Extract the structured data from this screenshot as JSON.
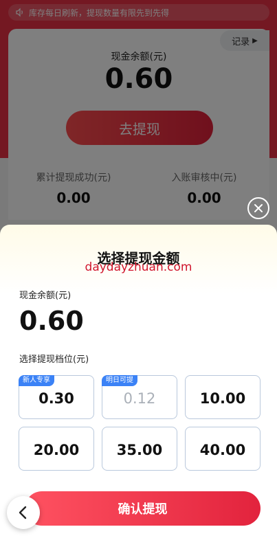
{
  "background": {
    "notice": {
      "icon": "speaker-icon",
      "text": "库存每日刷新，提现数量有限先到先得"
    },
    "balance_card": {
      "record_label": "记录",
      "label": "现金余额(元)",
      "amount": "0.60",
      "withdraw_label": "去提现"
    },
    "stats": [
      {
        "label": "累计提现成功(元)",
        "value": "0.00"
      },
      {
        "label": "入账审核中(元)",
        "value": "0.00"
      }
    ]
  },
  "sheet": {
    "title": "选择提现金额",
    "watermark": "daydayzhuan.com",
    "balance_label": "现金余额(元)",
    "balance_amount": "0.60",
    "tier_label": "选择提现档位(元)",
    "tiers": [
      {
        "value": "0.30",
        "badge": "新人专享",
        "disabled": false
      },
      {
        "value": "0.12",
        "badge": "明日可提",
        "disabled": true
      },
      {
        "value": "10.00",
        "badge": "",
        "disabled": false
      },
      {
        "value": "20.00",
        "badge": "",
        "disabled": false
      },
      {
        "value": "35.00",
        "badge": "",
        "disabled": false
      },
      {
        "value": "40.00",
        "badge": "",
        "disabled": false
      }
    ],
    "confirm_label": "确认提现"
  },
  "colors": {
    "brand_red": "#e83145",
    "badge_blue": "#3b82f6",
    "tier_border": "#b9c8dc"
  }
}
